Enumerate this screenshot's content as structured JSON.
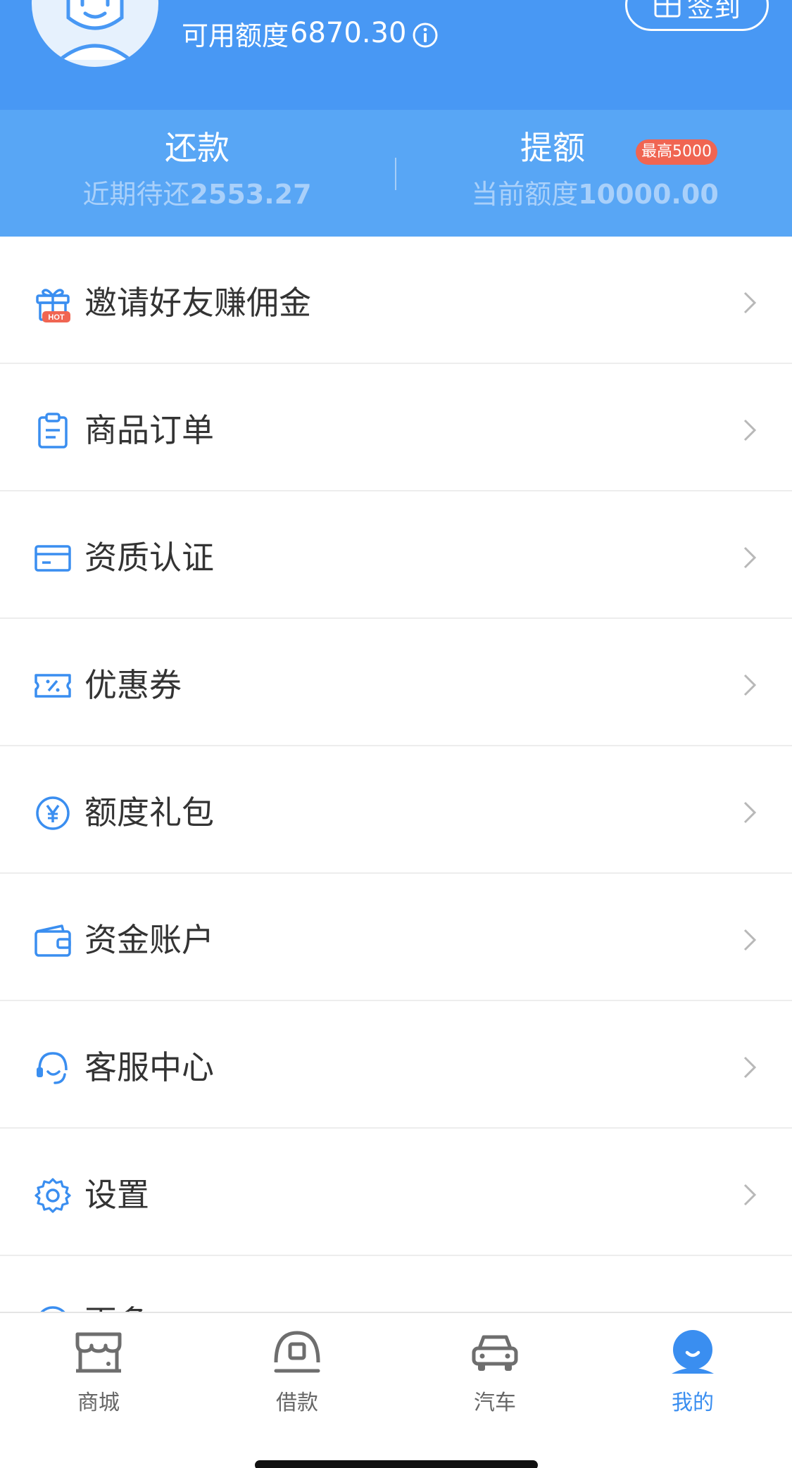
{
  "header": {
    "credit_label": "可用额度",
    "credit_value": "6870.30",
    "checkin_label": "签到",
    "colors": {
      "primary": "#4898F4",
      "band": "#58A6F5"
    }
  },
  "stats": {
    "repay": {
      "title": "还款",
      "sub_label": "近期待还",
      "sub_value": "2553.27"
    },
    "raise": {
      "title": "提额",
      "badge": "最高5000",
      "sub_label": "当前额度",
      "sub_value": "10000.00"
    }
  },
  "menu": {
    "items": [
      {
        "label": "邀请好友赚佣金",
        "icon": "gift-icon",
        "badge": "HOT"
      },
      {
        "label": "商品订单",
        "icon": "clipboard-icon"
      },
      {
        "label": "资质认证",
        "icon": "card-icon"
      },
      {
        "label": "优惠券",
        "icon": "coupon-icon"
      },
      {
        "label": "额度礼包",
        "icon": "yen-icon"
      },
      {
        "label": "资金账户",
        "icon": "wallet-icon"
      },
      {
        "label": "客服中心",
        "icon": "headset-icon"
      },
      {
        "label": "设置",
        "icon": "gear-icon"
      },
      {
        "label": "更多",
        "icon": "more-icon"
      }
    ]
  },
  "tabbar": {
    "tabs": [
      {
        "label": "商城",
        "icon": "store-icon"
      },
      {
        "label": "借款",
        "icon": "loan-icon"
      },
      {
        "label": "汽车",
        "icon": "car-icon"
      },
      {
        "label": "我的",
        "icon": "profile-icon",
        "active": true
      }
    ],
    "active_color": "#3A8EF0"
  }
}
